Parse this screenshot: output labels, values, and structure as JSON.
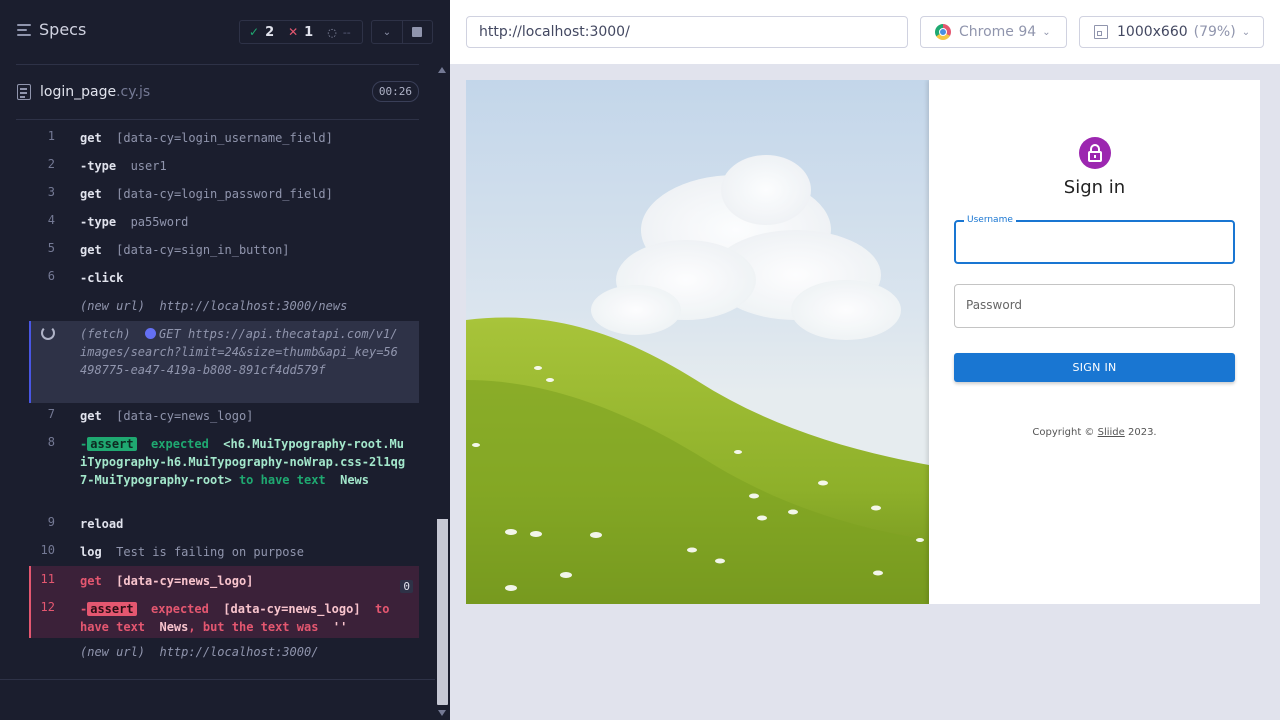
{
  "reporter": {
    "title": "Specs",
    "stats": {
      "passed": "2",
      "failed": "1",
      "pending": "--"
    },
    "spec": {
      "name": "login_page",
      "ext": ".cy.js",
      "duration": "00:26"
    },
    "commands": [
      {
        "num": "1",
        "name": "get",
        "arg": "[data-cy=login_username_field]"
      },
      {
        "num": "2",
        "name": "-type",
        "arg": "user1"
      },
      {
        "num": "3",
        "name": "get",
        "arg": "[data-cy=login_password_field]"
      },
      {
        "num": "4",
        "name": "-type",
        "arg": "pa55word"
      },
      {
        "num": "5",
        "name": "get",
        "arg": "[data-cy=sign_in_button]"
      },
      {
        "num": "6",
        "name": "-click",
        "arg": ""
      },
      {
        "num": "",
        "name": "(new url)",
        "arg": "http://localhost:3000/news"
      },
      {
        "num": "",
        "name": "(fetch)",
        "method": "GET",
        "arg": "https://api.thecatapi.com/v1/images/search?limit=24&size=thumb&api_key=56498775-ea47-419a-b808-891cf4dd579f"
      },
      {
        "num": "7",
        "name": "get",
        "arg": "[data-cy=news_logo]"
      },
      {
        "num": "8",
        "name": "-",
        "badge": "assert",
        "pre": "expected",
        "subject": "<h6.MuiTypography-root.MuiTypography-h6.MuiTypography-noWrap.css-2l1qg7-MuiTypography-root>",
        "mid": "to have text",
        "value": "News"
      },
      {
        "num": "9",
        "name": "reload",
        "arg": ""
      },
      {
        "num": "10",
        "name": "log",
        "arg": "Test is failing on purpose"
      },
      {
        "num": "11",
        "name": "get",
        "arg": "[data-cy=news_logo]",
        "count": "0"
      },
      {
        "num": "12",
        "name": "-",
        "badge": "assert",
        "pre": "expected",
        "subject": "[data-cy=news_logo]",
        "mid": "to have text",
        "value": "News",
        "post": ", but the text was",
        "actual": "''"
      },
      {
        "num": "",
        "name": "(new url)",
        "arg": "http://localhost:3000/"
      }
    ]
  },
  "aut": {
    "url": "http://localhost:3000/",
    "browser": "Chrome 94",
    "viewport": "1000x660",
    "scale": "(79%)"
  },
  "app": {
    "title": "Sign in",
    "username_label": "Username",
    "password_placeholder": "Password",
    "button": "SIGN IN",
    "copyright_pre": "Copyright © ",
    "copyright_link": "Sliide",
    "copyright_post": " 2023."
  },
  "colors": {
    "primary": "#1976d2",
    "avatar": "#9c27b0",
    "pass": "#1fa971",
    "fail": "#e45770"
  }
}
